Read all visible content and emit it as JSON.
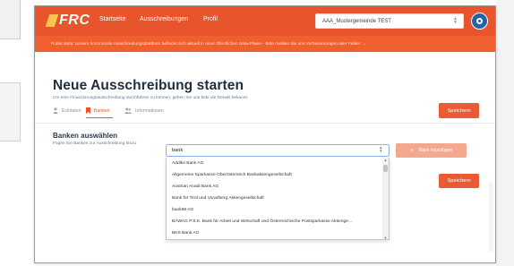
{
  "nav": {
    "logo_text": "FRC",
    "links": [
      "Startseite",
      "Ausschreibungen",
      "Profil"
    ],
    "tenant_selected": "AAA_Mustergemeinde TEST"
  },
  "banner": {
    "text": "Public Beta: Unsere kommunale Ausschreibungsplattform befindet sich aktuell in einer öffentlichen Beta-Phase - Bitte melden Sie uns Verbesserungen oder Fehler →"
  },
  "page": {
    "title": "Neue Ausschreibung starten",
    "subtitle": "Um eine Finanzierungsausschreibung durchführen zu können, geben Sie uns bitte die Details bekannt."
  },
  "tabs": [
    {
      "label": "Eckdaten",
      "icon": "person-icon"
    },
    {
      "label": "Banken",
      "icon": "bookmark-icon",
      "active": true
    },
    {
      "label": "Informationen",
      "icon": "people-icon"
    }
  ],
  "actions": {
    "save_label": "Speichern"
  },
  "banks_section": {
    "title": "Banken auswählen",
    "description": "Fügen Sie Banken zur Ausschreibung hinzu",
    "search_value": "bank",
    "add_button_label": "Bank hinzufügen",
    "options": [
      "Addiko Bank AG",
      "Allgemeine Sparkasse Oberösterreich Bankaktiengesellschaft",
      "Austrian Anadi Bank AG",
      "Bank für Tirol und Vorarlberg Aktiengesellschaft",
      "bank99 AG",
      "BAWAG P.S.K. Bank für Arbeit und Wirtschaft und Österreichische Postsparkasse Aktienge...",
      "BKS Bank AG"
    ]
  },
  "colors": {
    "brand": "#e8542c",
    "banner": "#f0602f",
    "primary_button": "#ec5a35",
    "add_button": "#f3a88f",
    "user_button": "#2563a8"
  }
}
